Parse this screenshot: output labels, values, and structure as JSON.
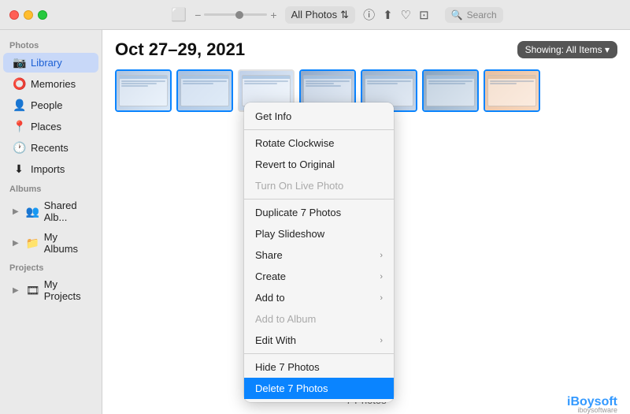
{
  "titlebar": {
    "dropdown_label": "All Photos",
    "search_placeholder": "Search",
    "zoom_icon": "⊞"
  },
  "sidebar": {
    "section_photos": "Photos",
    "section_albums": "Albums",
    "section_projects": "Projects",
    "items_photos": [
      {
        "label": "Library",
        "icon": "📷",
        "active": true
      },
      {
        "label": "Memories",
        "icon": "⭕"
      },
      {
        "label": "People",
        "icon": "👤"
      },
      {
        "label": "Places",
        "icon": "📍"
      },
      {
        "label": "Recents",
        "icon": "🕐"
      },
      {
        "label": "Imports",
        "icon": "⬇"
      }
    ],
    "items_albums": [
      {
        "label": "Shared Alb...",
        "icon": "👥",
        "expandable": true
      },
      {
        "label": "My Albums",
        "icon": "📁",
        "expandable": true
      }
    ],
    "items_projects": [
      {
        "label": "My Projects",
        "icon": "🎞",
        "expandable": true
      }
    ]
  },
  "main": {
    "title": "Oct 27–29, 2021",
    "showing_label": "Showing: All Items ▾",
    "footer_count": "7 Photos"
  },
  "context_menu": {
    "items": [
      {
        "label": "Get Info",
        "id": "get-info",
        "disabled": false,
        "has_arrow": false,
        "separator_after": false
      },
      {
        "label": "Rotate Clockwise",
        "id": "rotate-clockwise",
        "disabled": false,
        "has_arrow": false,
        "separator_after": false
      },
      {
        "label": "Revert to Original",
        "id": "revert-original",
        "disabled": false,
        "has_arrow": false,
        "separator_after": false
      },
      {
        "label": "Turn On Live Photo",
        "id": "live-photo",
        "disabled": true,
        "has_arrow": false,
        "separator_after": true
      },
      {
        "label": "Duplicate 7 Photos",
        "id": "duplicate",
        "disabled": false,
        "has_arrow": false,
        "separator_after": false
      },
      {
        "label": "Play Slideshow",
        "id": "slideshow",
        "disabled": false,
        "has_arrow": false,
        "separator_after": false
      },
      {
        "label": "Share",
        "id": "share",
        "disabled": false,
        "has_arrow": true,
        "separator_after": false
      },
      {
        "label": "Create",
        "id": "create",
        "disabled": false,
        "has_arrow": true,
        "separator_after": false
      },
      {
        "label": "Add to",
        "id": "add-to",
        "disabled": false,
        "has_arrow": true,
        "separator_after": false
      },
      {
        "label": "Add to Album",
        "id": "add-to-album",
        "disabled": true,
        "has_arrow": false,
        "separator_after": false
      },
      {
        "label": "Edit With",
        "id": "edit-with",
        "disabled": false,
        "has_arrow": true,
        "separator_after": true
      },
      {
        "label": "Hide 7 Photos",
        "id": "hide",
        "disabled": false,
        "has_arrow": false,
        "separator_after": false
      },
      {
        "label": "Delete 7 Photos",
        "id": "delete",
        "disabled": false,
        "highlighted": true,
        "has_arrow": false,
        "separator_after": false
      }
    ]
  },
  "watermark": {
    "text": "iBoysoft",
    "subtext": "iboysoftware"
  },
  "thumbs": [
    {
      "class": "thumb-1",
      "selected": true
    },
    {
      "class": "thumb-2",
      "selected": true
    },
    {
      "class": "thumb-3",
      "selected": false
    },
    {
      "class": "thumb-4",
      "selected": true
    },
    {
      "class": "thumb-5",
      "selected": true
    },
    {
      "class": "thumb-6",
      "selected": true
    },
    {
      "class": "thumb-7",
      "selected": true
    }
  ]
}
